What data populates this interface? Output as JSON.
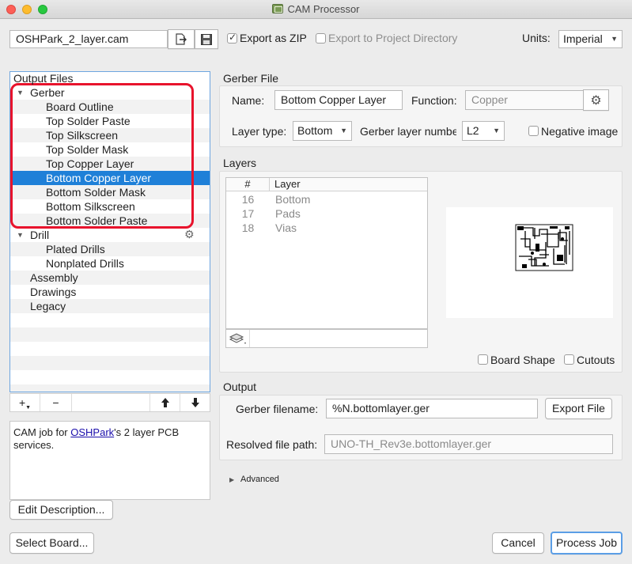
{
  "window": {
    "title": "CAM Processor"
  },
  "top": {
    "cam_file": "OSHPark_2_layer.cam",
    "export_zip_label": "Export as ZIP",
    "export_zip_checked": true,
    "export_project_label": "Export to Project Directory",
    "export_project_checked": false,
    "units_label": "Units:",
    "units_value": "Imperial"
  },
  "output_files": {
    "header": "Output Files",
    "items": [
      {
        "label": "Gerber",
        "level": 0,
        "expanded": true
      },
      {
        "label": "Board Outline",
        "level": 1
      },
      {
        "label": "Top Solder Paste",
        "level": 1
      },
      {
        "label": "Top Silkscreen",
        "level": 1
      },
      {
        "label": "Top Solder Mask",
        "level": 1
      },
      {
        "label": "Top Copper Layer",
        "level": 1
      },
      {
        "label": "Bottom Copper Layer",
        "level": 1,
        "selected": true
      },
      {
        "label": "Bottom Solder Mask",
        "level": 1
      },
      {
        "label": "Bottom Silkscreen",
        "level": 1
      },
      {
        "label": "Bottom Solder Paste",
        "level": 1
      },
      {
        "label": "Drill",
        "level": 0,
        "expanded": true
      },
      {
        "label": "Plated Drills",
        "level": 1
      },
      {
        "label": "Nonplated Drills",
        "level": 1
      },
      {
        "label": "Assembly",
        "level": 0
      },
      {
        "label": "Drawings",
        "level": 0
      },
      {
        "label": "Legacy",
        "level": 0
      }
    ],
    "toolbar": {
      "add": "+",
      "remove": "−",
      "up": "🡅",
      "down": "🡇"
    }
  },
  "description": {
    "text_before": "CAM job for ",
    "link_text": "OSHPark",
    "text_after": "'s 2 layer PCB services.",
    "edit_button": "Edit Description..."
  },
  "gerber_file": {
    "section": "Gerber File",
    "name_label": "Name:",
    "name_value": "Bottom Copper Layer",
    "function_label": "Function:",
    "function_value": "Copper",
    "layer_type_label": "Layer type:",
    "layer_type_value": "Bottom",
    "gerber_layer_label": "Gerber layer numbe",
    "gerber_layer_value": "L2",
    "negative_label": "Negative image",
    "negative_checked": false
  },
  "layers": {
    "section": "Layers",
    "col_num": "#",
    "col_layer": "Layer",
    "rows": [
      {
        "num": "16",
        "name": "Bottom"
      },
      {
        "num": "17",
        "name": "Pads"
      },
      {
        "num": "18",
        "name": "Vias"
      }
    ],
    "board_shape_label": "Board Shape",
    "cutouts_label": "Cutouts"
  },
  "output": {
    "section": "Output",
    "gerber_filename_label": "Gerber filename:",
    "gerber_filename_value": "%N.bottomlayer.ger",
    "export_file_button": "Export File",
    "resolved_label": "Resolved file path:",
    "resolved_value": "UNO-TH_Rev3e.bottomlayer.ger",
    "advanced_label": "Advanced"
  },
  "footer": {
    "select_board": "Select Board...",
    "cancel": "Cancel",
    "process_job": "Process Job"
  },
  "colors": {
    "selection": "#1f80d8",
    "highlight_box": "#e8132c"
  }
}
